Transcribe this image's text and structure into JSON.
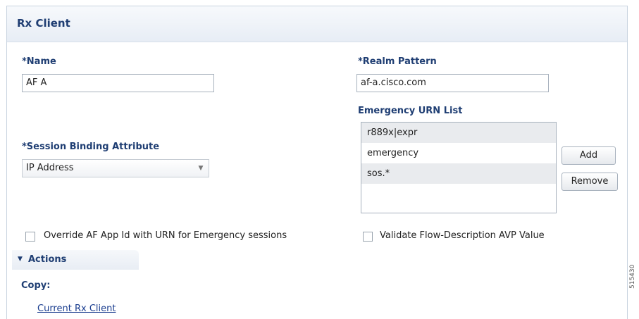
{
  "panel": {
    "title": "Rx Client"
  },
  "name_field": {
    "label": "*Name",
    "value": "AF A"
  },
  "realm_field": {
    "label": "*Realm Pattern",
    "value": "af-a.cisco.com"
  },
  "urn_list": {
    "label": "Emergency URN List",
    "items": [
      "r889x|expr",
      "emergency",
      "sos.*"
    ],
    "add_label": "Add",
    "remove_label": "Remove"
  },
  "session_binding": {
    "label": "*Session Binding Attribute",
    "selected": "IP Address",
    "arrow_icon": "chevron-down-icon"
  },
  "checkboxes": {
    "override_label": "Override AF App Id with URN for Emergency sessions",
    "override_checked": false,
    "validate_label": "Validate Flow-Description AVP Value",
    "validate_checked": false
  },
  "actions": {
    "title": "Actions",
    "copy_label": "Copy:",
    "current_link": "Current Rx Client"
  },
  "figure_id": "515430"
}
